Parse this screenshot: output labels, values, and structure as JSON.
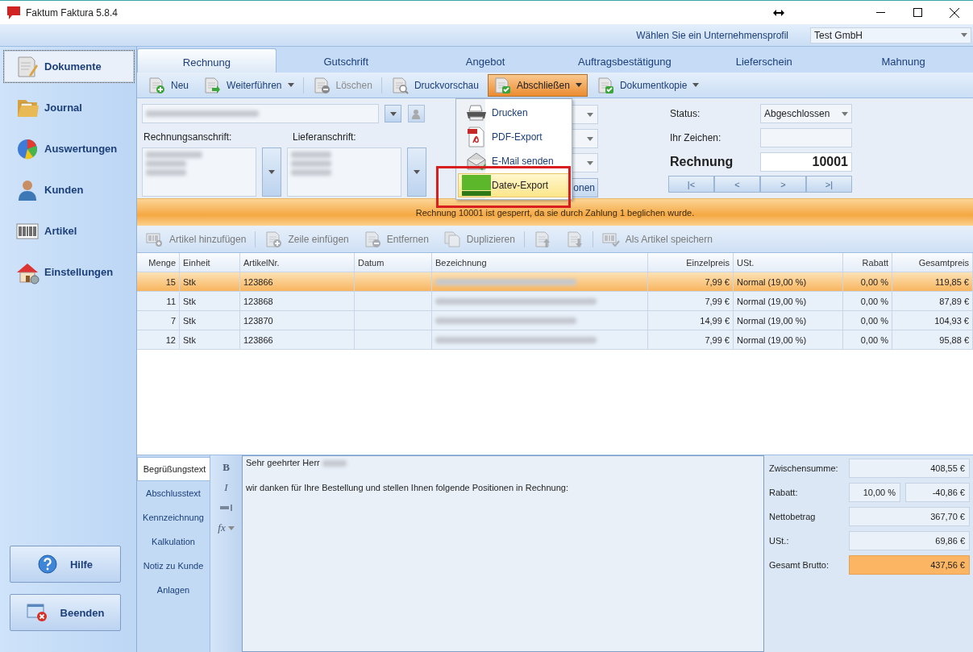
{
  "window": {
    "title": "Faktum Faktura 5.8.4"
  },
  "profile": {
    "label": "Wählen Sie ein Unternehmensprofil",
    "value": "Test GmbH"
  },
  "sidebar": {
    "items": [
      {
        "label": "Dokumente",
        "selected": true
      },
      {
        "label": "Journal",
        "selected": false
      },
      {
        "label": "Auswertungen",
        "selected": false
      },
      {
        "label": "Kunden",
        "selected": false
      },
      {
        "label": "Artikel",
        "selected": false
      },
      {
        "label": "Einstellungen",
        "selected": false
      }
    ],
    "buttons": [
      {
        "label": "Hilfe"
      },
      {
        "label": "Beenden"
      }
    ]
  },
  "tabs": [
    {
      "label": "Rechnung",
      "selected": true
    },
    {
      "label": "Gutschrift",
      "selected": false
    },
    {
      "label": "Angebot",
      "selected": false
    },
    {
      "label": "Auftragsbestätigung",
      "selected": false
    },
    {
      "label": "Lieferschein",
      "selected": false
    },
    {
      "label": "Mahnung",
      "selected": false
    }
  ],
  "toolbar": [
    {
      "label": "Neu",
      "dropdown": false,
      "disabled": false,
      "open": false
    },
    {
      "label": "Weiterführen",
      "dropdown": true,
      "disabled": false,
      "open": false
    },
    {
      "label": "Löschen",
      "dropdown": false,
      "disabled": true,
      "open": false
    },
    {
      "label": "Druckvorschau",
      "dropdown": false,
      "disabled": false,
      "open": false
    },
    {
      "label": "Abschließen",
      "dropdown": true,
      "disabled": false,
      "open": true
    },
    {
      "label": "Dokumentkopie",
      "dropdown": true,
      "disabled": false,
      "open": false
    }
  ],
  "menu": {
    "items": [
      {
        "label": "Drucken",
        "highlighted": false
      },
      {
        "label": "PDF-Export",
        "highlighted": false
      },
      {
        "label": "E-Mail senden",
        "highlighted": false
      },
      {
        "label": "Datev-Export",
        "highlighted": true
      }
    ]
  },
  "form": {
    "billing_label": "Rechnungsanschrift:",
    "shipping_label": "Lieferanschrift:",
    "button": "onen",
    "status_label": "Status:",
    "status": "Abgeschlossen",
    "reference_label": "Ihr Zeichen:",
    "document_label": "Rechnung",
    "document_number": "10001",
    "nav": [
      "|<",
      "<",
      ">",
      ">|"
    ]
  },
  "banner": "Rechnung 10001 ist gesperrt, da sie durch Zahlung 1 beglichen wurde.",
  "item_toolbar": [
    {
      "label": "Artikel hinzufügen",
      "disabled": true
    },
    {
      "label": "Zeile einfügen",
      "disabled": true
    },
    {
      "label": "Entfernen",
      "disabled": true
    },
    {
      "label": "Duplizieren",
      "disabled": true
    },
    {
      "disabled": true
    },
    {
      "disabled": true
    },
    {
      "label": "Als Artikel speichern",
      "disabled": true
    }
  ],
  "table": {
    "columns": [
      "Menge",
      "Einheit",
      "ArtikelNr.",
      "Datum",
      "Bezeichnung",
      "Einzelpreis",
      "USt.",
      "Rabatt",
      "Gesamtpreis"
    ],
    "rows": [
      {
        "quantity": "15",
        "unit": "Stk",
        "article_no": "123866",
        "unit_price": "7,99 €",
        "tax": "Normal (19,00 %)",
        "discount": "0,00 %",
        "total": "119,85 €",
        "selected": true
      },
      {
        "quantity": "11",
        "unit": "Stk",
        "article_no": "123868",
        "unit_price": "7,99 €",
        "tax": "Normal (19,00 %)",
        "discount": "0,00 %",
        "total": "87,89 €",
        "selected": false
      },
      {
        "quantity": "7",
        "unit": "Stk",
        "article_no": "123870",
        "unit_price": "14,99 €",
        "tax": "Normal (19,00 %)",
        "discount": "0,00 %",
        "total": "104,93 €",
        "selected": false
      },
      {
        "quantity": "12",
        "unit": "Stk",
        "article_no": "123866",
        "unit_price": "7,99 €",
        "tax": "Normal (19,00 %)",
        "discount": "0,00 %",
        "total": "95,88 €",
        "selected": false
      }
    ]
  },
  "text_tabs": [
    {
      "label": "Begrüßungstext",
      "selected": true
    },
    {
      "label": "Abschlusstext",
      "selected": false
    },
    {
      "label": "Kennzeichnung",
      "selected": false
    },
    {
      "label": "Kalkulation",
      "selected": false
    },
    {
      "label": "Notiz zu Kunde",
      "selected": false
    },
    {
      "label": "Anlagen",
      "selected": false
    }
  ],
  "format_buttons": [
    {
      "kind": "bold",
      "label": "B"
    },
    {
      "kind": "italic",
      "label": "I"
    },
    {
      "kind": "indent"
    },
    {
      "kind": "formula",
      "label": "fx"
    }
  ],
  "editor": {
    "salutation": "Sehr geehrter Herr",
    "body": "wir danken für Ihre Bestellung und stellen Ihnen folgende Positionen in Rechnung:"
  },
  "totals": [
    {
      "label": "Zwischensumme:",
      "value": "408,55 €",
      "highlighted": false
    },
    {
      "label": "Rabatt:",
      "percent": "10,00 %",
      "value": "-40,86 €",
      "highlighted": false
    },
    {
      "label": "Nettobetrag",
      "value": "367,70 €",
      "highlighted": false
    },
    {
      "label": "USt.:",
      "value": "69,86 €",
      "highlighted": false
    },
    {
      "label": "Gesamt Brutto:",
      "value": "437,56 €",
      "highlighted": true
    }
  ]
}
